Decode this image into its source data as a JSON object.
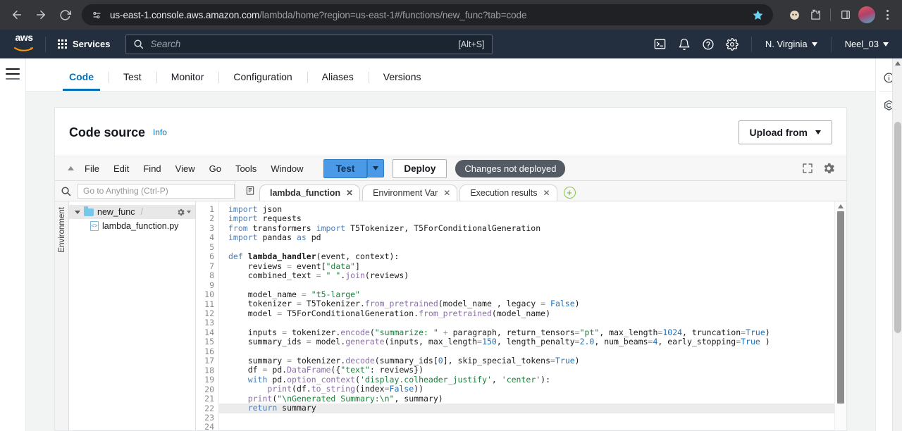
{
  "browser": {
    "back_label": "Back",
    "forward_label": "Forward",
    "reload_label": "Reload",
    "site_info_label": "site-settings",
    "url_host": "us-east-1.console.aws.amazon.com",
    "url_path": "/lambda/home?region=us-east-1#/functions/new_func?tab=code",
    "bookmark_label": "Bookmark this tab",
    "extensions_label": "Extensions",
    "side_panel_label": "Side panel",
    "profile_label": "Profile",
    "menu_label": "Customize and control"
  },
  "aws_nav": {
    "logo_text": "aws",
    "services_label": "Services",
    "search_placeholder": "Search",
    "search_value": "",
    "search_shortcut": "[Alt+S]",
    "cloudshell_label": "CloudShell",
    "notifications_label": "Notifications",
    "help_label": "Help",
    "settings_label": "Settings",
    "region_label": "N. Virginia",
    "account_label": "Neel_03"
  },
  "tabs": [
    {
      "label": "Code",
      "active": true
    },
    {
      "label": "Test",
      "active": false
    },
    {
      "label": "Monitor",
      "active": false
    },
    {
      "label": "Configuration",
      "active": false
    },
    {
      "label": "Aliases",
      "active": false
    },
    {
      "label": "Versions",
      "active": false
    }
  ],
  "card": {
    "title": "Code source",
    "info_label": "Info",
    "upload_label": "Upload from"
  },
  "ide": {
    "menus": [
      "File",
      "Edit",
      "Find",
      "View",
      "Go",
      "Tools",
      "Window"
    ],
    "test_label": "Test",
    "deploy_label": "Deploy",
    "changes_badge": "Changes not deployed",
    "goto_placeholder": "Go to Anything (Ctrl-P)",
    "goto_value": "",
    "editor_tabs": [
      {
        "label": "lambda_function",
        "active": true
      },
      {
        "label": "Environment Var",
        "active": false
      },
      {
        "label": "Execution results",
        "active": false
      }
    ],
    "add_tab_label": "+",
    "env_strip_label": "Environment",
    "tree": {
      "folder": "new_func",
      "folder_suffix": "/",
      "file": "lambda_function.py"
    }
  },
  "code": {
    "current_line": 22,
    "lines": [
      {
        "n": 1,
        "html": "<span class='tok-kw'>import</span> json"
      },
      {
        "n": 2,
        "html": "<span class='tok-kw'>import</span> requests"
      },
      {
        "n": 3,
        "html": "<span class='tok-kw'>from</span> transformers <span class='tok-kw'>import</span> T5Tokenizer, T5ForConditionalGeneration"
      },
      {
        "n": 4,
        "html": "<span class='tok-kw'>import</span> pandas <span class='tok-kw'>as</span> pd"
      },
      {
        "n": 5,
        "html": ""
      },
      {
        "n": 6,
        "html": "<span class='tok-def'>def</span> <span style='font-weight:bold'>lambda_handler</span>(event, context):"
      },
      {
        "n": 7,
        "html": "    reviews <span class='tok-op'>=</span> event[<span class='tok-str'>\"data\"</span>]"
      },
      {
        "n": 8,
        "html": "    combined_text <span class='tok-op'>=</span> <span class='tok-str'>\" \"</span>.<span class='tok-fn'>join</span>(reviews)"
      },
      {
        "n": 9,
        "html": ""
      },
      {
        "n": 10,
        "html": "    model_name <span class='tok-op'>=</span> <span class='tok-str'>\"t5-large\"</span>"
      },
      {
        "n": 11,
        "html": "    tokenizer <span class='tok-op'>=</span> T5Tokenizer.<span class='tok-fn'>from_pretrained</span>(model_name , legacy <span class='tok-op'>=</span> <span class='tok-const'>False</span>)"
      },
      {
        "n": 12,
        "html": "    model <span class='tok-op'>=</span> T5ForConditionalGeneration.<span class='tok-fn'>from_pretrained</span>(model_name)"
      },
      {
        "n": 13,
        "html": ""
      },
      {
        "n": 14,
        "html": "    inputs <span class='tok-op'>=</span> tokenizer.<span class='tok-fn'>encode</span>(<span class='tok-str'>\"summarize: \"</span> <span class='tok-op'>+</span> paragraph, return_tensors<span class='tok-op'>=</span><span class='tok-str'>\"pt\"</span>, max_length<span class='tok-op'>=</span><span class='tok-num'>1024</span>, truncation<span class='tok-op'>=</span><span class='tok-const'>True</span>)"
      },
      {
        "n": 15,
        "html": "    summary_ids <span class='tok-op'>=</span> model.<span class='tok-fn'>generate</span>(inputs, max_length<span class='tok-op'>=</span><span class='tok-num'>150</span>, length_penalty<span class='tok-op'>=</span><span class='tok-num'>2.0</span>, num_beams<span class='tok-op'>=</span><span class='tok-num'>4</span>, early_stopping<span class='tok-op'>=</span><span class='tok-const'>True</span> )"
      },
      {
        "n": 16,
        "html": ""
      },
      {
        "n": 17,
        "html": "    summary <span class='tok-op'>=</span> tokenizer.<span class='tok-fn'>decode</span>(summary_ids[<span class='tok-num'>0</span>], skip_special_tokens<span class='tok-op'>=</span><span class='tok-const'>True</span>)"
      },
      {
        "n": 18,
        "html": "    df <span class='tok-op'>=</span> pd.<span class='tok-fn'>DataFrame</span>({<span class='tok-str'>\"text\"</span>: reviews})"
      },
      {
        "n": 19,
        "html": "    <span class='tok-kw'>with</span> pd.<span class='tok-fn'>option_context</span>(<span class='tok-str'>'display.colheader_justify'</span>, <span class='tok-str'>'center'</span>):"
      },
      {
        "n": 20,
        "html": "        <span class='tok-fn'>print</span>(df.<span class='tok-fn'>to_string</span>(index<span class='tok-op'>=</span><span class='tok-const'>False</span>))"
      },
      {
        "n": 21,
        "html": "    <span class='tok-fn'>print</span>(<span class='tok-str'>\"\\nGenerated Summary:\\n\"</span>, summary)"
      },
      {
        "n": 22,
        "html": "    <span class='tok-kw'>return</span> summary"
      },
      {
        "n": 23,
        "html": ""
      },
      {
        "n": 24,
        "html": ""
      }
    ]
  },
  "right_rail": {
    "info_label": "Info panel",
    "shortcuts_label": "Quick actions"
  },
  "colors": {
    "brand_blue": "#0073bb",
    "nav_dark": "#232f3e",
    "test_button": "#4a9ae8",
    "badge_gray": "#545b64"
  }
}
